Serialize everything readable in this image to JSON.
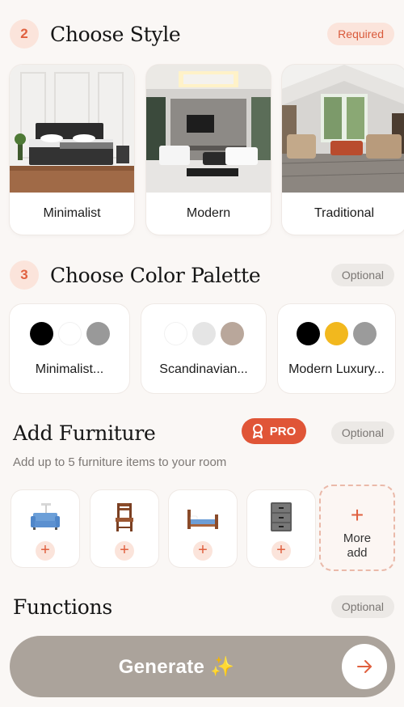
{
  "style_section": {
    "step": "2",
    "title": "Choose Style",
    "badge": "Required",
    "styles": [
      {
        "label": "Minimalist"
      },
      {
        "label": "Modern"
      },
      {
        "label": "Traditional"
      }
    ]
  },
  "palette_section": {
    "step": "3",
    "title": "Choose Color Palette",
    "badge": "Optional",
    "palettes": [
      {
        "label": "Minimalist...",
        "colors": [
          "#000000",
          "#ffffff",
          "#999999"
        ]
      },
      {
        "label": "Scandinavian...",
        "colors": [
          "#ffffff",
          "#e5e5e5",
          "#b9a79b"
        ]
      },
      {
        "label": "Modern Luxury...",
        "colors": [
          "#000000",
          "#f2b81e",
          "#9b9b9b"
        ]
      }
    ]
  },
  "furniture_section": {
    "title": "Add Furniture",
    "pro_label": "PRO",
    "badge": "Optional",
    "subtitle": "Add up to 5 furniture items to your room",
    "items": [
      {
        "icon": "sofa-icon"
      },
      {
        "icon": "chair-icon"
      },
      {
        "icon": "bed-icon"
      },
      {
        "icon": "cabinet-icon"
      }
    ],
    "more_plus": "+",
    "more_label_line1": "More",
    "more_label_line2": "add"
  },
  "functions_section": {
    "title": "Functions",
    "badge": "Optional"
  },
  "generate": {
    "label": "Generate ✨"
  },
  "colors": {
    "accent": "#e0603f",
    "pro": "#e05537",
    "generate_bar": "#aba39b"
  }
}
